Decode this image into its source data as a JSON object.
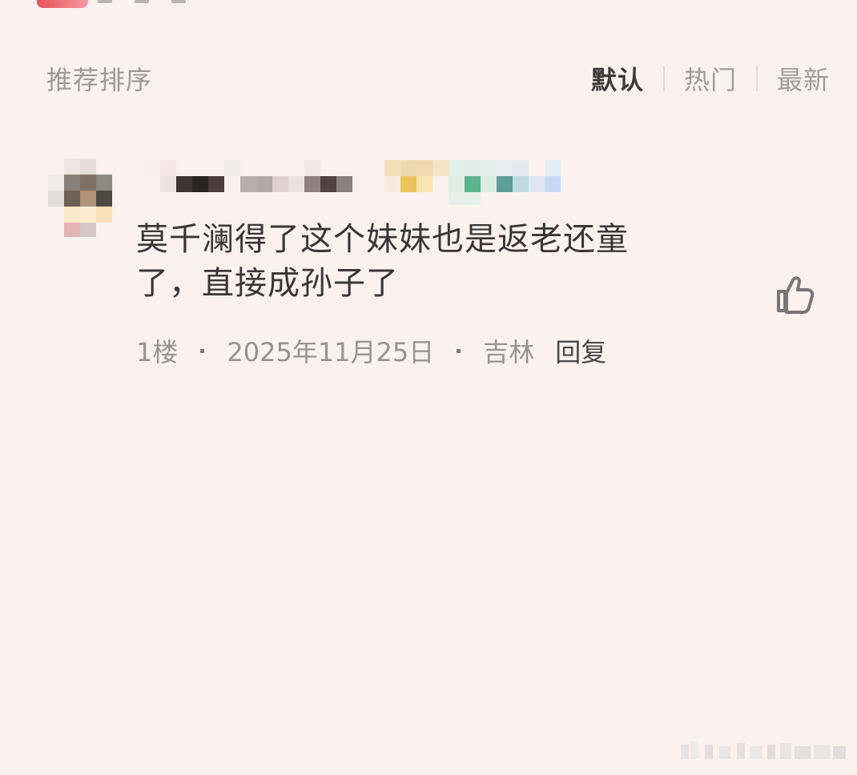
{
  "sort": {
    "title": "推荐排序",
    "options": [
      "默认",
      "热门",
      "最新"
    ],
    "active": "默认"
  },
  "comment": {
    "username": "",
    "text_line1": "莫千澜得了这个妹妹也是返老还童",
    "text_line2": "了，直接成孙子了",
    "floor": "1楼",
    "date": "2025年11月25日",
    "location": "吉林",
    "reply_label": "回复"
  },
  "icons": {
    "like": "thumbs-up-icon"
  }
}
